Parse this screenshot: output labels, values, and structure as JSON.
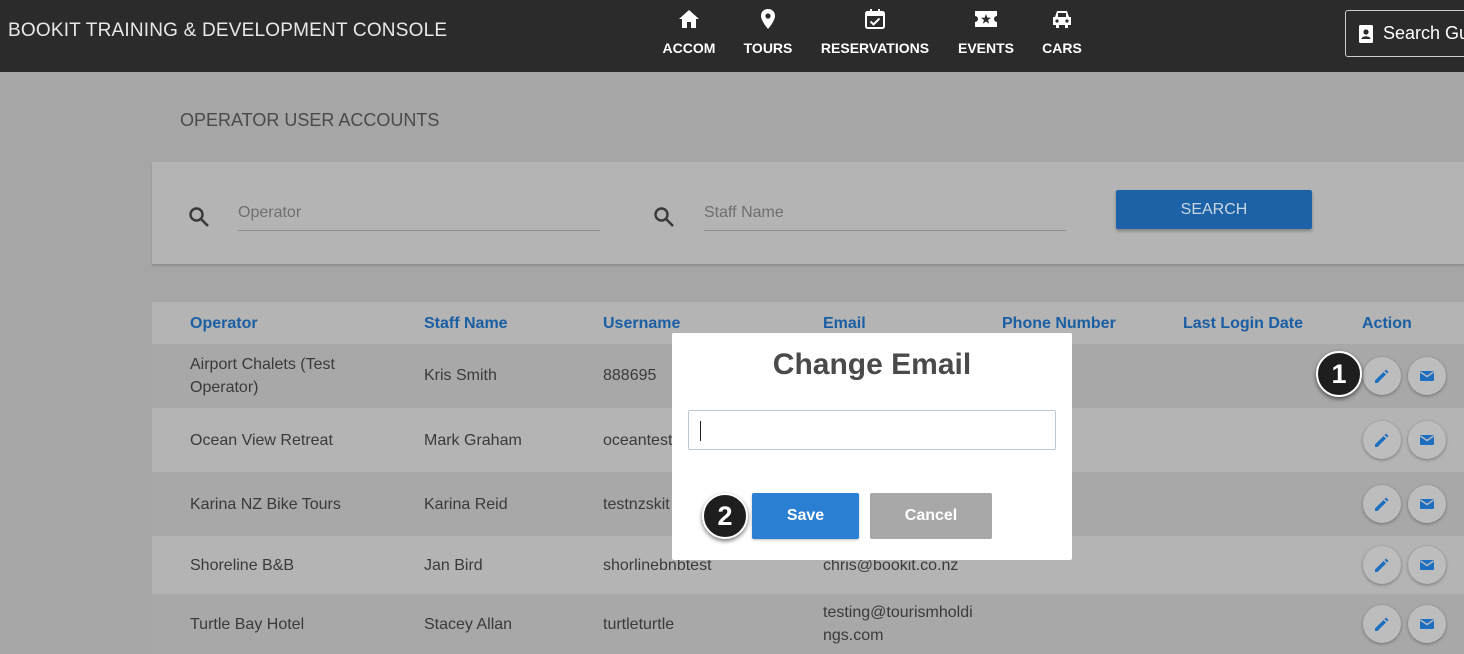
{
  "app": {
    "title": "BOOKIT TRAINING & DEVELOPMENT CONSOLE"
  },
  "nav": [
    {
      "label": "ACCOM",
      "icon": "home-icon"
    },
    {
      "label": "TOURS",
      "icon": "map-pin-icon"
    },
    {
      "label": "RESERVATIONS",
      "icon": "calendar-check-icon"
    },
    {
      "label": "EVENTS",
      "icon": "ticket-star-icon"
    },
    {
      "label": "CARS",
      "icon": "car-icon"
    }
  ],
  "header": {
    "search_guest_label": "Search Gu"
  },
  "page": {
    "title": "OPERATOR USER ACCOUNTS"
  },
  "search": {
    "operator_placeholder": "Operator",
    "operator_value": "",
    "staff_placeholder": "Staff Name",
    "staff_value": "",
    "button_label": "SEARCH"
  },
  "table": {
    "columns": [
      "Operator",
      "Staff Name",
      "Username",
      "Email",
      "Phone Number",
      "Last Login Date",
      "Action"
    ],
    "rows": [
      {
        "operator": "Airport Chalets (Test Operator)",
        "staff": "Kris Smith",
        "username": "888695",
        "email": "",
        "phone": "",
        "last_login": ""
      },
      {
        "operator": "Ocean View Retreat",
        "staff": "Mark Graham",
        "username": "oceantest",
        "email": "",
        "phone": "",
        "last_login": ""
      },
      {
        "operator": "Karina NZ Bike Tours",
        "staff": "Karina Reid",
        "username": "testnzskit",
        "email": "",
        "phone": "",
        "last_login": ""
      },
      {
        "operator": "Shoreline B&B",
        "staff": "Jan Bird",
        "username": "shorlinebnbtest",
        "email": "chris@bookit.co.nz",
        "phone": "",
        "last_login": ""
      },
      {
        "operator": "Turtle Bay Hotel",
        "staff": "Stacey Allan",
        "username": "turtleturtle",
        "email": "testing@tourismholdi ngs.com",
        "phone": "",
        "last_login": ""
      }
    ]
  },
  "modal": {
    "title": "Change Email",
    "email_value": "",
    "save_label": "Save",
    "cancel_label": "Cancel"
  },
  "callouts": {
    "one": "1",
    "two": "2"
  },
  "colors": {
    "topbar": "#2b2b2b",
    "accent_blue": "#2b7fd3",
    "header_text_blue": "#1a5ea3",
    "cancel_grey": "#a8a8a8"
  }
}
